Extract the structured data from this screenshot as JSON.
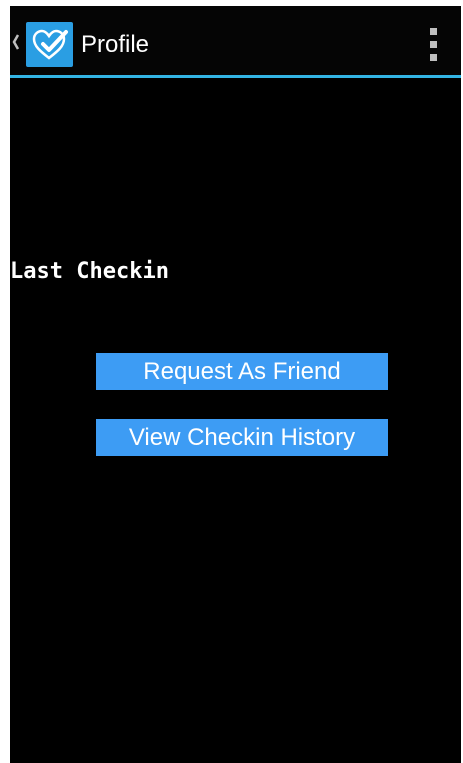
{
  "action_bar": {
    "title": "Profile",
    "up_icon": "chevron-left-icon",
    "app_icon": "heart-check-icon",
    "overflow_icon": "overflow-menu-icon",
    "accent_color": "#33b5e5"
  },
  "main": {
    "section_label": "Last Checkin",
    "request_friend_label": "Request As Friend",
    "view_history_label": "View Checkin History",
    "button_color": "#3d9cf4"
  }
}
